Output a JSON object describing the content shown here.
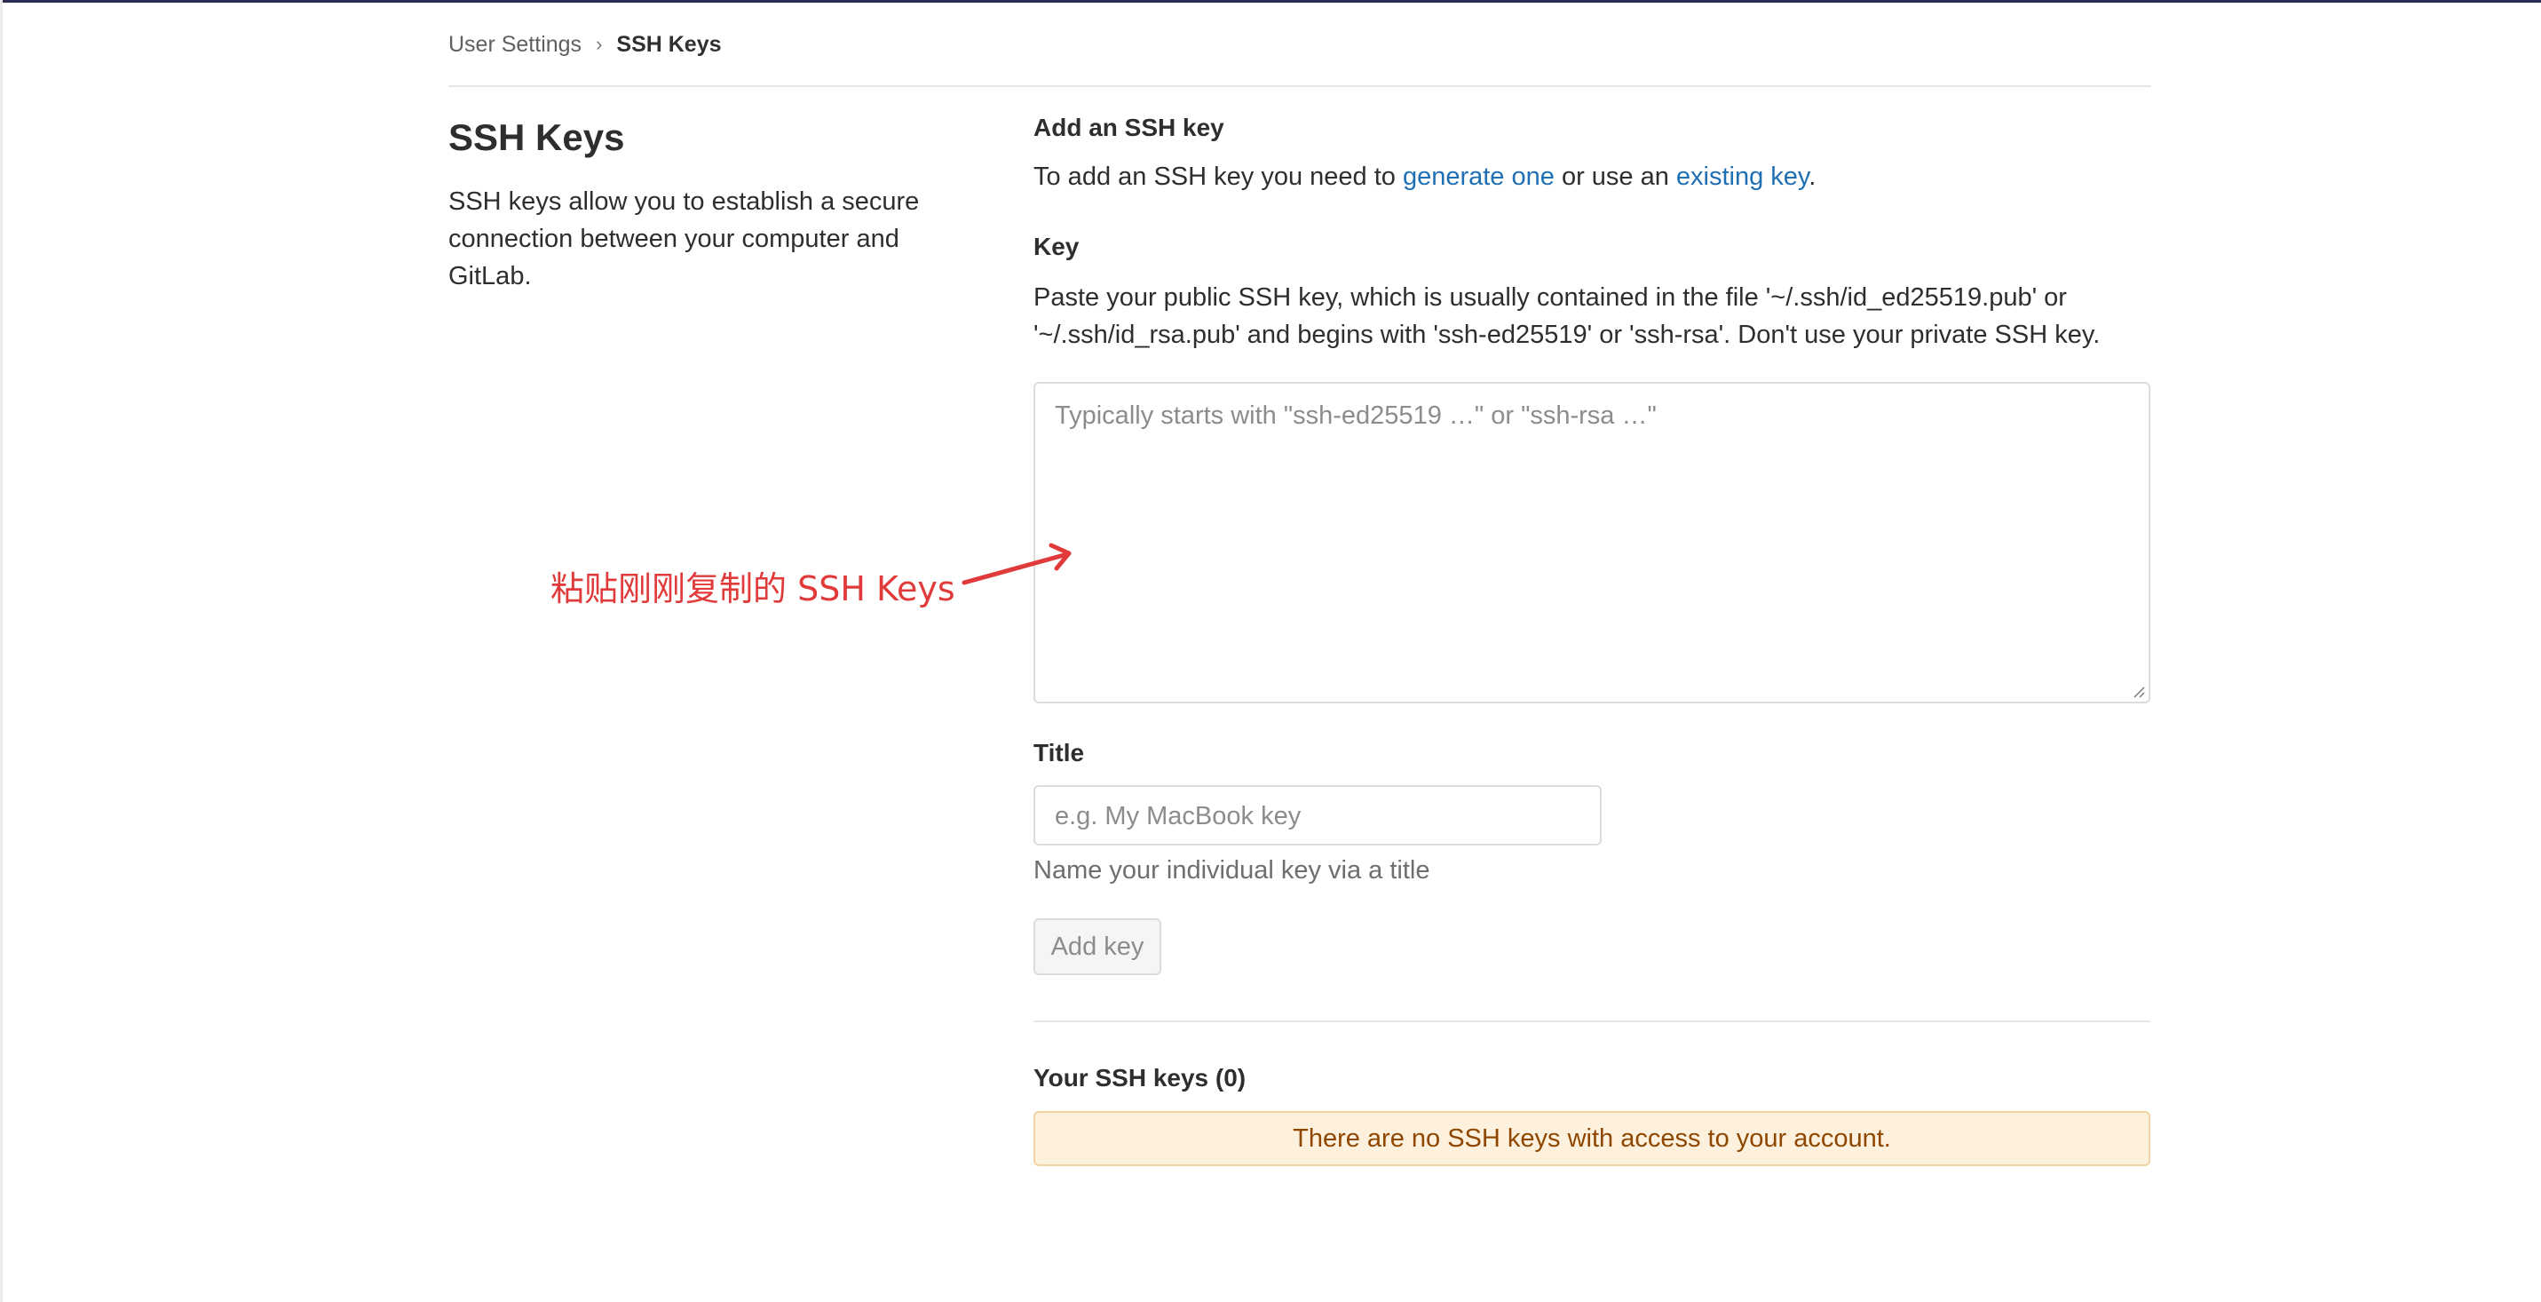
{
  "breadcrumb": {
    "parent": "User Settings",
    "separator": "›",
    "current": "SSH Keys"
  },
  "sidebar": {
    "title": "SSH Keys",
    "description": "SSH keys allow you to establish a secure connection between your computer and GitLab."
  },
  "form": {
    "heading": "Add an SSH key",
    "intro_prefix": "To add an SSH key you need to ",
    "generate_link": "generate one",
    "intro_middle": " or use an ",
    "existing_link": "existing key",
    "intro_suffix": ".",
    "key_label": "Key",
    "key_help": "Paste your public SSH key, which is usually contained in the file '~/.ssh/id_ed25519.pub' or '~/.ssh/id_rsa.pub' and begins with 'ssh-ed25519' or 'ssh-rsa'. Don't use your private SSH key.",
    "key_placeholder": "Typically starts with \"ssh-ed25519 …\" or \"ssh-rsa …\"",
    "title_label": "Title",
    "title_placeholder": "e.g. My MacBook key",
    "title_help": "Name your individual key via a title",
    "submit_label": "Add key"
  },
  "keys_list": {
    "heading": "Your SSH keys (0)",
    "empty_message": "There are no SSH keys with access to your account."
  },
  "annotation": {
    "text": "粘贴刚刚复制的 SSH Keys",
    "color": "#e03a3a"
  },
  "colors": {
    "link": "#1f6fb5",
    "alert_bg": "#fdf1dd",
    "alert_text": "#8f4700",
    "top_bar": "#2b2a54"
  }
}
